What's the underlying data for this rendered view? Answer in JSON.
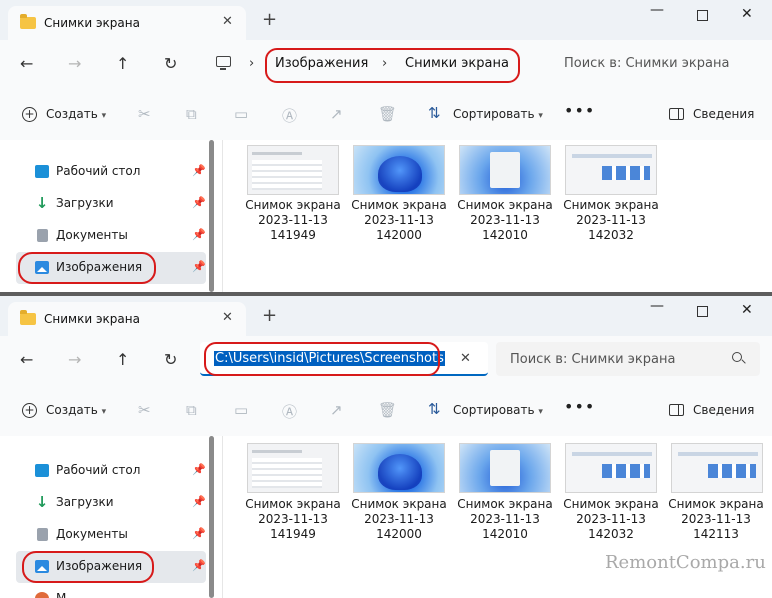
{
  "window": {
    "tab_title": "Снимки экрана",
    "tab_close": "✕",
    "new_tab": "+",
    "minimize": "—",
    "close": "✕"
  },
  "nav": {
    "back": "←",
    "forward": "→",
    "up": "↑",
    "refresh": "↻"
  },
  "breadcrumb": {
    "items": [
      "Изображения",
      "Снимки экрана"
    ],
    "separator": "›",
    "root_chevron": "›"
  },
  "address": {
    "path_value": "C:\\Users\\insid\\Pictures\\Screenshots",
    "clear": "✕"
  },
  "search": {
    "placeholder": "Поиск в: Снимки экрана"
  },
  "commands": {
    "create": "Создать",
    "sort": "Сортировать",
    "more": "•••",
    "details": "Сведения",
    "icons": [
      "cut-icon",
      "copy-icon",
      "paste-icon",
      "rename-icon",
      "share-icon",
      "delete-icon"
    ]
  },
  "sidebar": {
    "items": [
      {
        "label": "Рабочий стол",
        "icon": "desktop-icon"
      },
      {
        "label": "Загрузки",
        "icon": "downloads-icon"
      },
      {
        "label": "Документы",
        "icon": "documents-icon"
      },
      {
        "label": "Изображения",
        "icon": "pictures-icon",
        "selected": true
      }
    ],
    "partial_item": "М",
    "pin": "📌"
  },
  "files_top": [
    {
      "name": "Снимок экрана",
      "date": "2023-11-13",
      "time": "141949",
      "thumb": "explorer-window"
    },
    {
      "name": "Снимок экрана",
      "date": "2023-11-13",
      "time": "142000",
      "thumb": "win11-bloom"
    },
    {
      "name": "Снимок экрана",
      "date": "2023-11-13",
      "time": "142010",
      "thumb": "start-menu"
    },
    {
      "name": "Снимок экрана",
      "date": "2023-11-13",
      "time": "142032",
      "thumb": "explorer-tiles"
    }
  ],
  "files_bottom": [
    {
      "name": "Снимок экрана",
      "date": "2023-11-13",
      "time": "141949",
      "thumb": "explorer-window"
    },
    {
      "name": "Снимок экрана",
      "date": "2023-11-13",
      "time": "142000",
      "thumb": "win11-bloom"
    },
    {
      "name": "Снимок экрана",
      "date": "2023-11-13",
      "time": "142010",
      "thumb": "start-menu"
    },
    {
      "name": "Снимок экрана",
      "date": "2023-11-13",
      "time": "142032",
      "thumb": "explorer-tiles"
    },
    {
      "name": "Снимок экрана",
      "date": "2023-11-13",
      "time": "142113",
      "thumb": "explorer-tiles"
    }
  ],
  "watermark": "RemontCompa.ru",
  "colors": {
    "highlight_ring": "#d71a1a",
    "selection": "#0060c0",
    "tabbar": "#eef2f6",
    "folder": "#f6c444"
  }
}
